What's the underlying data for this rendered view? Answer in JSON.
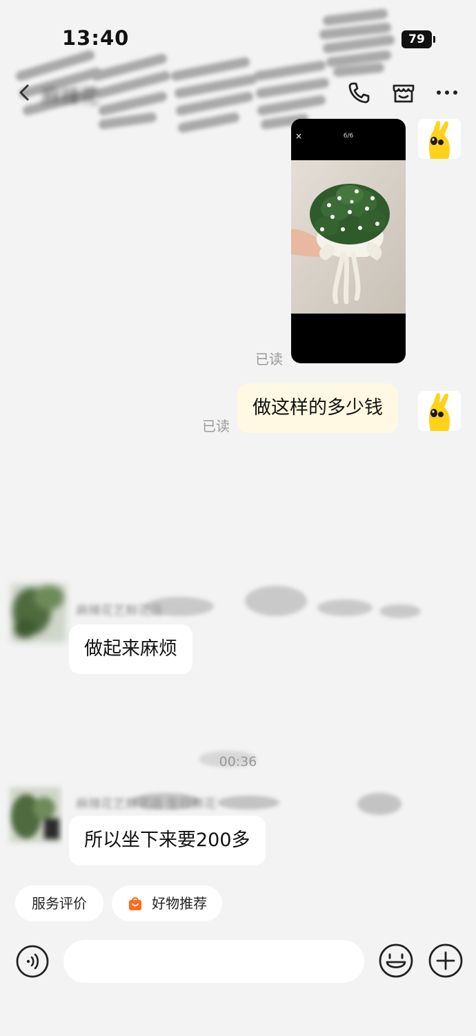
{
  "status_bar": {
    "time": "13:40",
    "battery": "79"
  },
  "header": {
    "title": "麻辣花"
  },
  "messages": {
    "image": {
      "counter": "6/6",
      "close": "×"
    },
    "read_label_1": "已读",
    "read_label_2": "已读",
    "outgoing_text": "做这样的多少钱",
    "sender_1": "麻辣花艺鲜花店",
    "incoming_1": "做起来麻烦",
    "timestamp": "00:36",
    "sender_2": "麻辣花艺鲜花店 生日鲜花",
    "incoming_2": "所以坐下来要200多"
  },
  "quick_replies": [
    {
      "label": "服务评价"
    },
    {
      "label": "好物推荐"
    }
  ],
  "input": {
    "placeholder": ""
  },
  "icons": {
    "back": "back-icon",
    "phone": "phone-icon",
    "store": "store-icon",
    "more": "more-icon",
    "voice": "voice-icon",
    "emoji": "emoji-icon",
    "plus": "plus-icon",
    "bag": "shopping-bag-icon"
  },
  "colors": {
    "background": "#f3f3f3",
    "outgoing_bubble": "#fff8e3",
    "incoming_bubble": "#ffffff",
    "bag_orange": "#ff6a1a",
    "avatar_yellow": "#ffd21a"
  }
}
